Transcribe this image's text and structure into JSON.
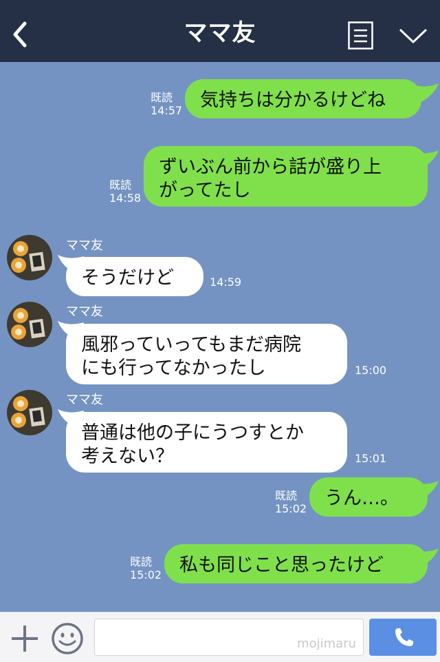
{
  "header": {
    "title": "ママ友"
  },
  "colors": {
    "header_bg": "#252f45",
    "chat_bg": "#7493c2",
    "outgoing_bubble": "#80e04b",
    "incoming_bubble": "#ffffff",
    "call_button": "#5b8fe4"
  },
  "messages": [
    {
      "direction": "out",
      "lines": [
        "気持ちは分かるけどね"
      ],
      "read": "既読",
      "time": "14:57"
    },
    {
      "direction": "out",
      "lines": [
        "ずいぶん前から話が盛り上",
        "がってたし"
      ],
      "read": "既読",
      "time": "14:58"
    },
    {
      "direction": "in",
      "sender": "ママ友",
      "lines": [
        "そうだけど"
      ],
      "time": "14:59"
    },
    {
      "direction": "in",
      "sender": "ママ友",
      "lines": [
        "風邪っていってもまだ病院",
        "にも行ってなかったし"
      ],
      "time": "15:00"
    },
    {
      "direction": "in",
      "sender": "ママ友",
      "lines": [
        "普通は他の子にうつすとか",
        "考えない？"
      ],
      "time": "15:01"
    },
    {
      "direction": "out",
      "lines": [
        "うん…。"
      ],
      "read": "既読",
      "time": "15:02"
    },
    {
      "direction": "out",
      "lines": [
        "私も同じこと思ったけど"
      ],
      "read": "既読",
      "time": "15:02"
    }
  ],
  "footer": {
    "watermark": "mojimaru",
    "icons": [
      "plus-icon",
      "smile-icon",
      "phone-icon"
    ]
  }
}
